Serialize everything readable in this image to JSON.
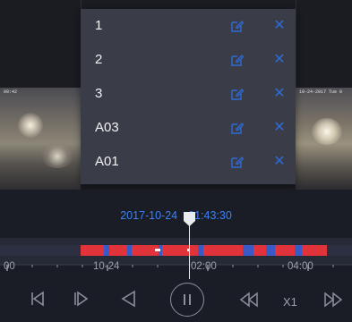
{
  "dropdown": {
    "items": [
      {
        "label": "1"
      },
      {
        "label": "2"
      },
      {
        "label": "3"
      },
      {
        "label": "A03"
      },
      {
        "label": "A01"
      }
    ]
  },
  "cameras": {
    "left_osd": "09:42",
    "right_osd": "10-24-2017 Tue 0"
  },
  "timeline": {
    "timestamp_date": "2017-10-24",
    "timestamp_time": "01:43:30",
    "axis_labels": {
      "left": "00",
      "mid": "10-24",
      "center": "02:00",
      "right": "04:00"
    }
  },
  "controls": {
    "speed_label": "X1"
  },
  "colors": {
    "accent_blue": "#3b82f6",
    "close_blue": "#2f6bd6",
    "record_red": "#e0333a",
    "record_blue": "#3b59c7"
  }
}
